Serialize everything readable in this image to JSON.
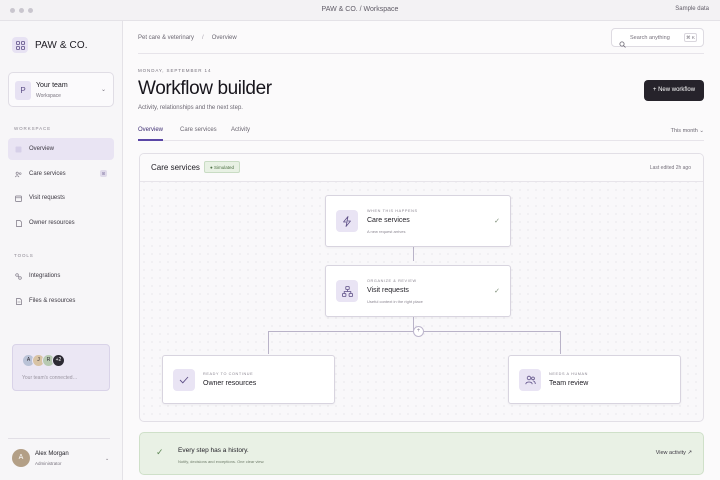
{
  "window": {
    "title": "PAW & CO. / Workspace",
    "right_label": "Sample data"
  },
  "sidebar": {
    "brand": "PAW & CO.",
    "team": {
      "name": "Your team",
      "sub": "Workspace",
      "initial": "P"
    },
    "sections": {
      "workspace": "WORKSPACE",
      "tools": "TOOLS"
    },
    "items": [
      {
        "label": "Overview",
        "icon": "overview-icon"
      },
      {
        "label": "Care services",
        "icon": "care-services-icon",
        "badge": "8"
      },
      {
        "label": "Visit requests",
        "icon": "calendar-icon"
      },
      {
        "label": "Owner resources",
        "icon": "document-icon"
      }
    ],
    "tools": [
      {
        "label": "Integrations",
        "icon": "integrations-icon"
      },
      {
        "label": "Files & resources",
        "icon": "file-icon"
      }
    ],
    "connected": {
      "avatars": [
        "A",
        "J",
        "R"
      ],
      "more": "+2",
      "text": "Your team's connected…"
    },
    "user": {
      "initial": "A",
      "name": "Alex Morgan",
      "role": "Administrator"
    }
  },
  "header": {
    "breadcrumb": [
      "Pet care & veterinary",
      "Overview"
    ],
    "search": {
      "placeholder": "Search anything",
      "shortcut": "⌘ K"
    },
    "date": "MONDAY, SEPTEMBER 14",
    "title": "Workflow builder",
    "subtitle": "Activity, relationships and the next step.",
    "new_button": "+ New workflow",
    "tabs": [
      "Overview",
      "Care services",
      "Activity"
    ],
    "range": "This month ⌄"
  },
  "canvas": {
    "title": "Care services",
    "badge": "Simulated",
    "edited": "Last edited 2h ago",
    "nodes": [
      {
        "eyebrow": "WHEN THIS HAPPENS",
        "title": "Care services",
        "desc": "A new request arrives",
        "icon": "lightning-icon",
        "check": "✓"
      },
      {
        "eyebrow": "ORGANIZE & REVIEW",
        "title": "Visit requests",
        "desc": "Useful context in the right place",
        "icon": "hierarchy-icon",
        "check": "✓"
      },
      {
        "eyebrow": "READY TO CONTINUE",
        "title": "Owner resources",
        "desc": "",
        "icon": "check-icon"
      },
      {
        "eyebrow": "NEEDS A HUMAN",
        "title": "Team review",
        "desc": "",
        "icon": "people-icon"
      }
    ]
  },
  "history": {
    "title": "Every step has a history.",
    "sub": "Notify, decisions and exceptions. One clear view.",
    "link": "View activity ↗"
  },
  "colors": {
    "accent": "#5a46a6",
    "dark_button": "#26232b",
    "success_bg": "#e9f1e5"
  }
}
